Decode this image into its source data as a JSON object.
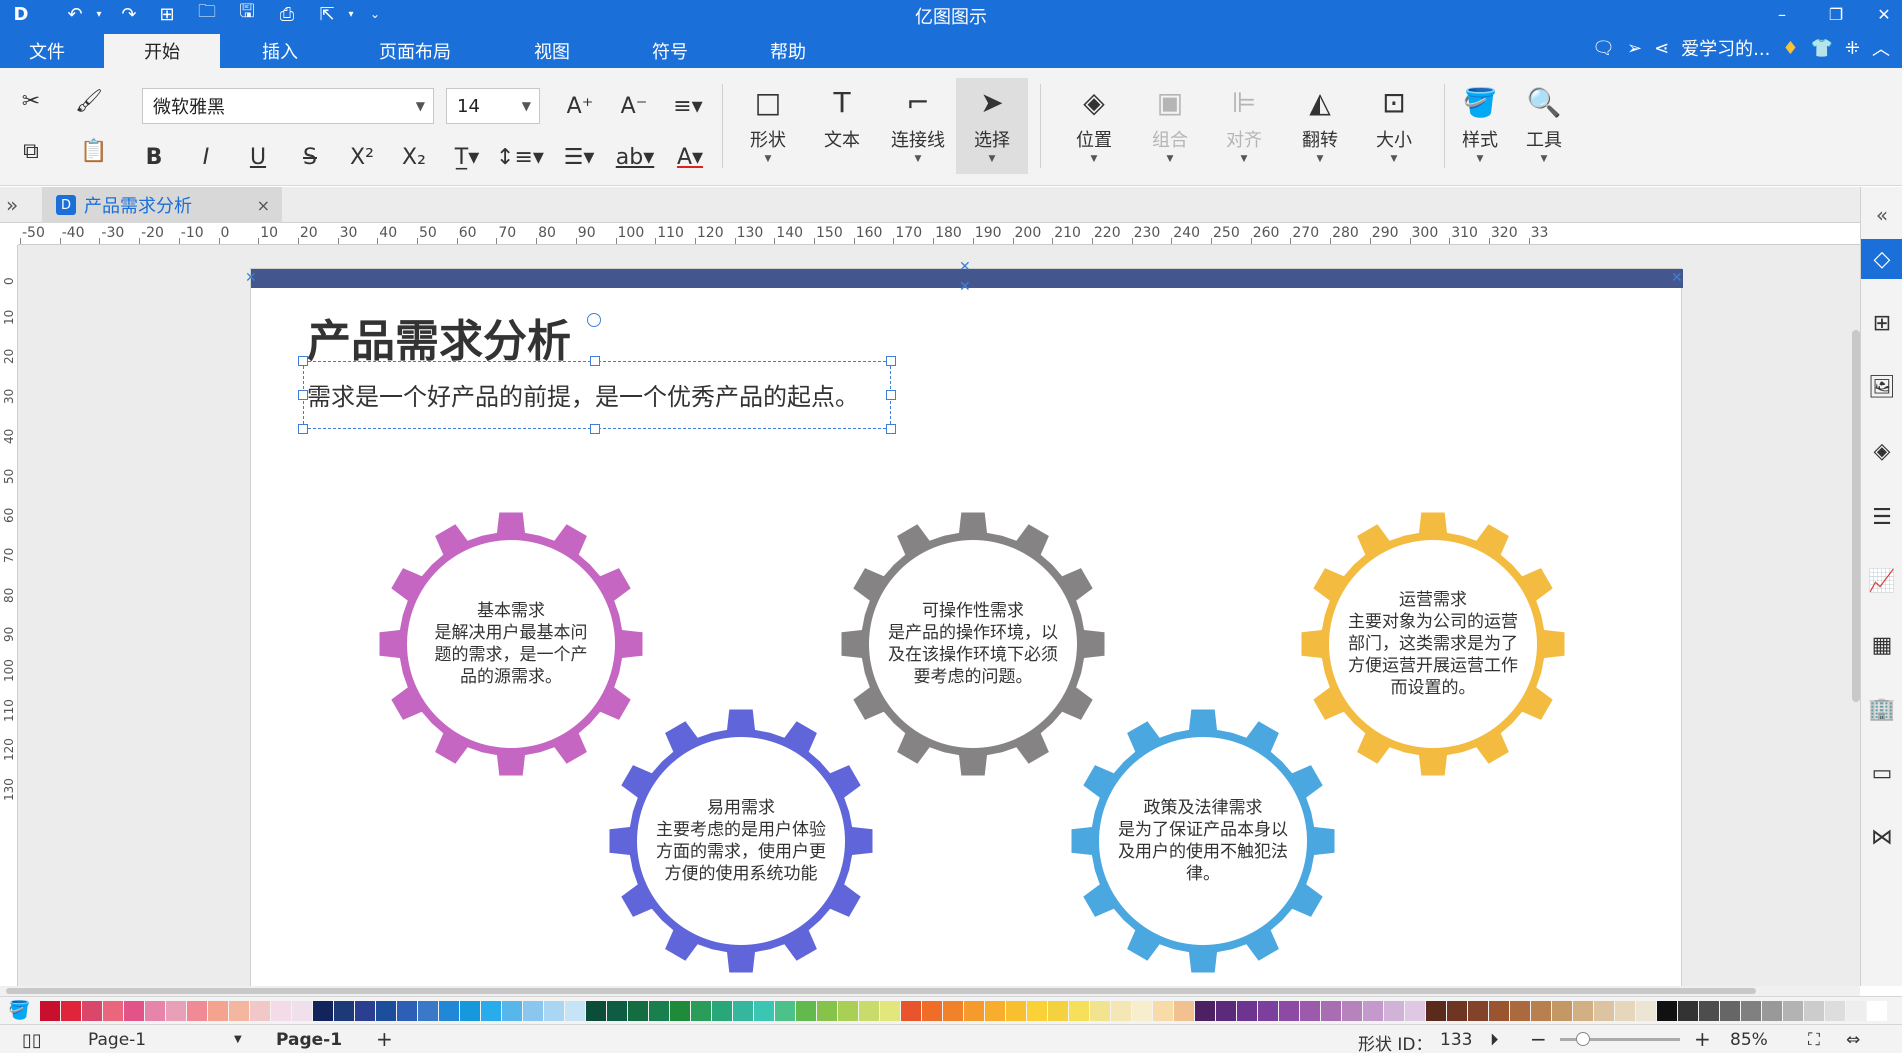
{
  "app_title": "亿图图示",
  "quick_access": [
    "logo-icon",
    "undo-icon",
    "redo-icon",
    "new-icon",
    "open-icon",
    "save-icon",
    "print-icon",
    "export-icon",
    "customize-icon"
  ],
  "menu": {
    "tabs": [
      "文件",
      "开始",
      "插入",
      "页面布局",
      "视图",
      "符号",
      "帮助"
    ],
    "active": "开始",
    "user_label": "爱学习的..."
  },
  "ribbon": {
    "font_family": "微软雅黑",
    "font_size": "14",
    "tools": {
      "shape": "形状",
      "text": "文本",
      "connector": "连接线",
      "select": "选择",
      "position": "位置",
      "group": "组合",
      "align": "对齐",
      "flip": "翻转",
      "size": "大小",
      "style": "样式",
      "tools": "工具"
    }
  },
  "document_tab": {
    "title": "产品需求分析",
    "close": "×"
  },
  "ruler": {
    "h_ticks": [
      "-50",
      "-40",
      "-30",
      "-20",
      "-10",
      "0",
      "10",
      "20",
      "30",
      "40",
      "50",
      "60",
      "70",
      "80",
      "90",
      "100",
      "110",
      "120",
      "130",
      "140",
      "150",
      "160",
      "170",
      "180",
      "190",
      "200",
      "210",
      "220",
      "230",
      "240",
      "250",
      "260",
      "270",
      "280",
      "290",
      "300",
      "310",
      "320",
      "33"
    ],
    "v_ticks": [
      "0",
      "10",
      "20",
      "30",
      "40",
      "50",
      "60",
      "70",
      "80",
      "90",
      "100",
      "110",
      "120",
      "130"
    ]
  },
  "page": {
    "title": "产品需求分析",
    "subtitle": "需求是一个好产品的前提，是一个优秀产品的起点。",
    "gears": [
      {
        "id": "basic",
        "color": "#c466c2",
        "title": "基本需求",
        "lines": [
          "是解决用户最基本问",
          "题的需求，是一个产",
          "品的源需求。"
        ]
      },
      {
        "id": "operability",
        "color": "#858384",
        "title": "可操作性需求",
        "lines": [
          "是产品的操作环境，以",
          "及在该操作环境下必须",
          "要考虑的问题。"
        ]
      },
      {
        "id": "operation",
        "color": "#f4bb41",
        "title": "运营需求",
        "lines": [
          "主要对象为公司的运营",
          "部门，这类需求是为了",
          "方便运营开展运营工作",
          "而设置的。"
        ]
      },
      {
        "id": "usability",
        "color": "#6066d9",
        "title": "易用需求",
        "lines": [
          "主要考虑的是用户体验",
          "方面的需求，使用户更",
          "方便的使用系统功能"
        ]
      },
      {
        "id": "legal",
        "color": "#4aa7df",
        "title": "政策及法律需求",
        "lines": [
          "是为了保证产品本身以",
          "及用户的使用不触犯法",
          "律。"
        ]
      }
    ]
  },
  "palette_colors": [
    "#c8102e",
    "#e0243a",
    "#d9486b",
    "#e9667d",
    "#e25387",
    "#e685a9",
    "#e8a0b8",
    "#f08a94",
    "#f4a48e",
    "#f5b6a0",
    "#f2c7c7",
    "#f4dbe8",
    "#f0e0ec",
    "#13245c",
    "#1c3a78",
    "#2b3f91",
    "#1d4e9c",
    "#2c5fb5",
    "#3a78c8",
    "#2088d6",
    "#1598dc",
    "#28acec",
    "#57b6ea",
    "#8ac6ee",
    "#a9d6f2",
    "#c7e3f6",
    "#0c4d3a",
    "#0f5c45",
    "#136d40",
    "#1a7f4f",
    "#1f8a3a",
    "#2a9d5a",
    "#28a87a",
    "#35b79d",
    "#3bc6b3",
    "#4dc18a",
    "#62b94e",
    "#86c34a",
    "#a9cf54",
    "#c9db6a",
    "#e2e77c",
    "#e8542b",
    "#ef6d28",
    "#f2822a",
    "#f59b2d",
    "#f8ad2e",
    "#f8bf2f",
    "#fad238",
    "#f4d23f",
    "#f6e05a",
    "#f2e48e",
    "#f5e6b6",
    "#f6eecd",
    "#f7dca9",
    "#f2c190",
    "#4d1f63",
    "#5c2a7a",
    "#6d3590",
    "#7c3f9d",
    "#8d4aa5",
    "#9b5aab",
    "#a96db2",
    "#b683bc",
    "#c39acb",
    "#d2b3d8",
    "#dfc8e4",
    "#5a2b1c",
    "#6e3622",
    "#82432a",
    "#9a5530",
    "#ab6a3e",
    "#b8804f",
    "#c49865",
    "#d2b084",
    "#ddc4a0",
    "#e5d6bc",
    "#ece4d5",
    "#111111",
    "#333333",
    "#4d4d4d",
    "#666666",
    "#808080",
    "#999999",
    "#b3b3b3",
    "#cccccc",
    "#dddddd",
    "#eeeeee",
    "#ffffff"
  ],
  "status": {
    "page_selector": "Page-1",
    "page_tab": "Page-1",
    "add": "+",
    "shape_id_label": "形状 ID：",
    "shape_id": "133",
    "zoom": "85%",
    "zoom_minus": "−",
    "zoom_plus": "+"
  }
}
